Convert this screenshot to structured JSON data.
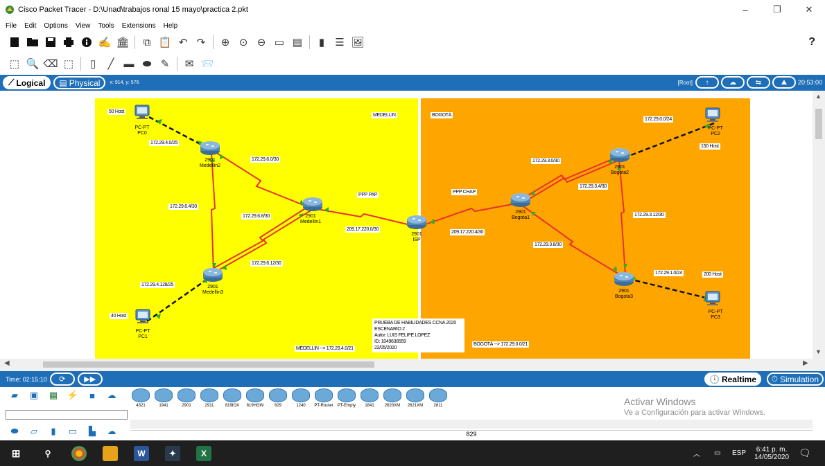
{
  "window": {
    "title": "Cisco Packet Tracer - D:\\Unad\\trabajos ronal 15 mayo\\practica 2.pkt",
    "controls": {
      "minimize": "–",
      "maximize": "❐",
      "close": "✕"
    }
  },
  "menu": [
    "File",
    "Edit",
    "Options",
    "View",
    "Tools",
    "Extensions",
    "Help"
  ],
  "toolbar": {
    "help": "?"
  },
  "modebar": {
    "logical": "Logical",
    "physical": "Physical",
    "coords": "x: 914, y: 576",
    "root": "[Root]",
    "clock": "20:53:00"
  },
  "topology": {
    "zones": {
      "medellin": {
        "title": "MEDELLIN",
        "network": "MEDELLIN --> 172.29.4.0/21",
        "color": "#ffff00"
      },
      "bogota": {
        "title": "BOGOTÁ",
        "network": "BOGOTÁ --> 172.29.0.0/21",
        "color": "#ffa500"
      }
    },
    "devices": [
      {
        "id": "pc0",
        "model": "PC-PT",
        "name": "PC0",
        "hosts": "50 Host"
      },
      {
        "id": "pc1",
        "model": "PC-PT",
        "name": "PC1",
        "hosts": "40 Host"
      },
      {
        "id": "pc2",
        "model": "PC-PT",
        "name": "PC2",
        "hosts": "150 Host"
      },
      {
        "id": "pc3",
        "model": "PC-PT",
        "name": "PC3",
        "hosts": "200 Host"
      },
      {
        "id": "medellin1",
        "model": "2901",
        "name": "Medellin1"
      },
      {
        "id": "medellin2",
        "model": "2901",
        "name": "Medellin2"
      },
      {
        "id": "medellin3",
        "model": "2901",
        "name": "Medellin3"
      },
      {
        "id": "isp",
        "model": "2901",
        "name": "ISP"
      },
      {
        "id": "bogota1",
        "model": "2901",
        "name": "Bogota1"
      },
      {
        "id": "bogota2",
        "model": "2901",
        "name": "Bogota2"
      },
      {
        "id": "bogota3",
        "model": "2901",
        "name": "Bogota3"
      }
    ],
    "links": [
      "172.29.4.0/25",
      "172.29.6.0/30",
      "172.29.6.4/30",
      "172.29.6.8/30",
      "172.29.6.12/30",
      "172.29.4.128/25",
      "PPP PAP",
      "209.17.220.0/30",
      "PPP CHAP",
      "209.17.220.4/30",
      "172.29.3.0/30",
      "172.29.3.4/30",
      "172.29.0.0/24",
      "172.29.3.12/30",
      "172.29.3.8/30",
      "172.29.1.0/24"
    ],
    "note": [
      "PRUEBA DE HABILIDADES CCNA 2020",
      "ESCENARIO 2",
      "Autor: LUIS FELIPE LOPEZ",
      "ID: 1049638559",
      "22/05/2020"
    ]
  },
  "simbar": {
    "time": "Time: 02:15:10",
    "realtime": "Realtime",
    "simulation": "Simulation"
  },
  "device_panel": {
    "models": [
      "4321",
      "1941",
      "2901",
      "2911",
      "819IOX",
      "819HGW",
      "829",
      "1240",
      "PT-Router",
      "PT-Empty",
      "1841",
      "2620XM",
      "2621XM",
      "2811"
    ],
    "selected": "829",
    "activate_title": "Activar Windows",
    "activate_sub": "Ve a Configuración para activar Windows."
  },
  "taskbar": {
    "lang": "ESP",
    "time": "6:41 p. m.",
    "date": "14/05/2020"
  },
  "colors": {
    "serial": "#e8322c",
    "ethernet": "#000000",
    "mode_blue": "#1e6fb8",
    "link_dot": "#2bb02b"
  }
}
